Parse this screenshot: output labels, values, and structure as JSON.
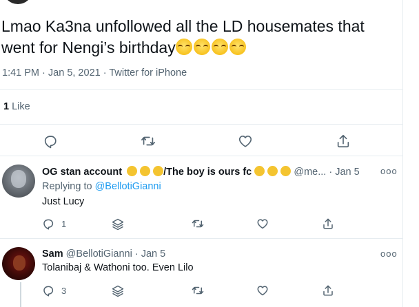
{
  "main_tweet": {
    "text": "Lmao Ka3na unfollowed all the LD housemates that went for Nengi’s birthday",
    "emojis": [
      "face-with-tears-of-joy",
      "face-with-tears-of-joy",
      "face-with-tears-of-joy",
      "face-with-tears-of-joy"
    ],
    "time": "1:41 PM",
    "date": "Jan 5, 2021",
    "source": "Twitter for iPhone",
    "sep": "·",
    "likes_count": "1",
    "likes_label": "Like"
  },
  "actions": [
    "reply-icon",
    "retweet-icon",
    "like-icon",
    "share-icon"
  ],
  "replies": [
    {
      "name": "OG stan account",
      "name_suffix": "/The boy is ours fc",
      "handle": "@me...",
      "sep": "·",
      "date": "Jan 5",
      "replying_prefix": "Replying to",
      "replying_handle": "@BellotiGianni",
      "text": "Just Lucy",
      "reply_count": "1",
      "more": "ooo"
    },
    {
      "name": "Sam",
      "handle": "@BellotiGianni",
      "sep": "·",
      "date": "Jan 5",
      "text": "Tolanibaj & Wathoni too. Even Lilo",
      "reply_count": "3",
      "more": "ooo"
    }
  ],
  "colors": {
    "text": "#0f1419",
    "muted": "#536471",
    "link": "#1d9bf0",
    "border": "#e6ecf0"
  }
}
